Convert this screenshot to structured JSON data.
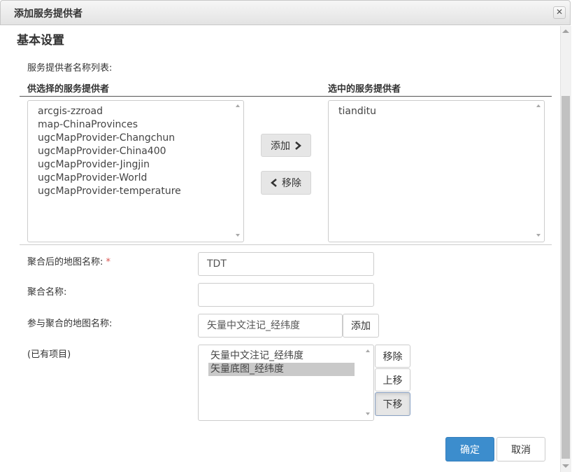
{
  "dialog": {
    "title": "添加服务提供者",
    "close_glyph": "✕"
  },
  "section": {
    "title": "基本设置",
    "list_caption": "服务提供者名称列表:"
  },
  "available": {
    "header": "供选择的服务提供者",
    "items": [
      "arcgis-zzroad",
      "map-ChinaProvinces",
      "ugcMapProvider-Changchun",
      "ugcMapProvider-China400",
      "ugcMapProvider-Jingjin",
      "ugcMapProvider-World",
      "ugcMapProvider-temperature"
    ]
  },
  "selected": {
    "header": "选中的服务提供者",
    "items": [
      "tianditu"
    ]
  },
  "transfer": {
    "add_label": "添加",
    "add_icon": "chevron-right-icon",
    "remove_label": "移除",
    "remove_icon": "chevron-left-icon"
  },
  "form": {
    "aggregated_map_name": {
      "label": "聚合后的地图名称:",
      "required_mark": "*",
      "value": "TDT"
    },
    "aggregation_name": {
      "label": "聚合名称:",
      "value": ""
    },
    "participating_map": {
      "label": "参与聚合的地图名称:",
      "value": "矢量中文注记_经纬度",
      "add_label": "添加"
    },
    "existing_items": {
      "label": "(已有项目)",
      "items": [
        "矢量中文注记_经纬度",
        "矢量底图_经纬度"
      ],
      "selected_index": 1,
      "remove_label": "移除",
      "up_label": "上移",
      "down_label": "下移"
    }
  },
  "footer": {
    "confirm_label": "确定",
    "cancel_label": "取消"
  },
  "colors": {
    "primary": "#3c8dcd",
    "required": "#d9534f"
  }
}
